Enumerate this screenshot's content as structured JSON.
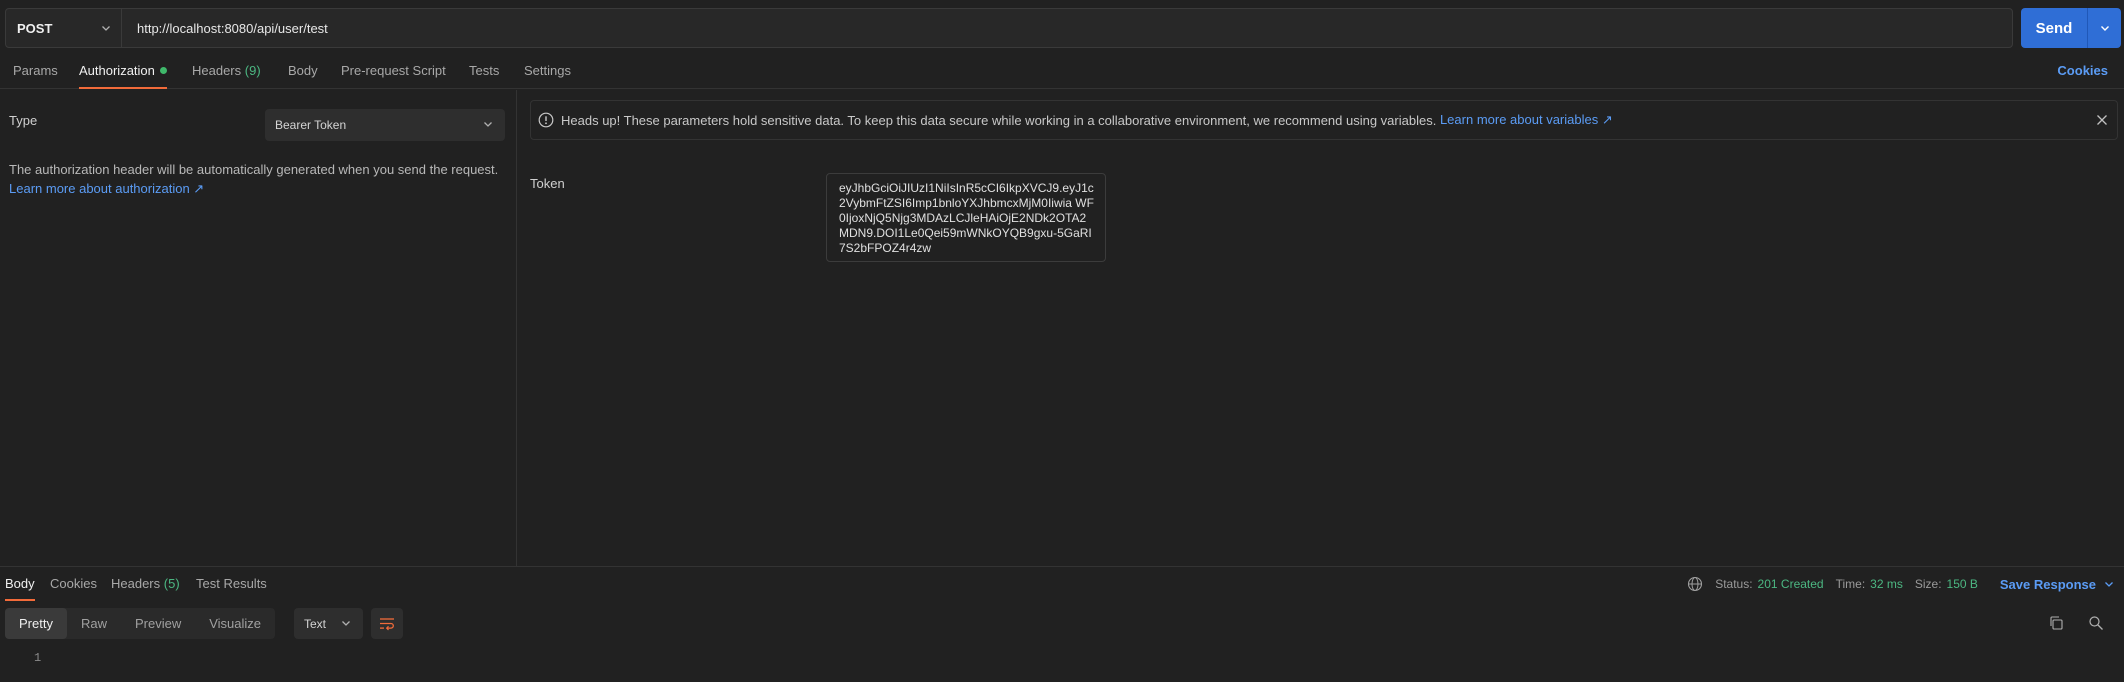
{
  "request": {
    "method": "POST",
    "url": "http://localhost:8080/api/user/test",
    "send_label": "Send"
  },
  "tabs": {
    "params": "Params",
    "authorization": "Authorization",
    "headers": "Headers",
    "headers_count": "(9)",
    "body": "Body",
    "prerequest": "Pre-request Script",
    "tests": "Tests",
    "settings": "Settings",
    "cookies": "Cookies"
  },
  "auth": {
    "type_label": "Type",
    "type_value": "Bearer Token",
    "description": "The authorization header will be automatically generated when you send the request.",
    "learn_link": "Learn more about authorization ↗",
    "banner_text": "Heads up! These parameters hold sensitive data. To keep this data secure while working in a collaborative environment, we recommend using variables.",
    "banner_link": "Learn more about variables ↗",
    "token_label": "Token",
    "token_value": "eyJhbGciOiJIUzI1NiIsInR5cCI6IkpXVCJ9.eyJ1c2VybmFtZSI6Imp1bnloYXJhbmcxMjM0Iiwia WF0IjoxNjQ5Njg3MDAzLCJleHAiOjE2NDk2OTA2MDN9.DOI1Le0Qei59mWNkOYQB9gxu-5GaRI7S2bFPOZ4r4zw"
  },
  "response": {
    "tabs": {
      "body": "Body",
      "cookies": "Cookies",
      "headers": "Headers",
      "headers_count": "(5)",
      "test_results": "Test Results"
    },
    "status_label": "Status:",
    "status_value": "201 Created",
    "time_label": "Time:",
    "time_value": "32 ms",
    "size_label": "Size:",
    "size_value": "150 B",
    "save_label": "Save Response",
    "views": {
      "pretty": "Pretty",
      "raw": "Raw",
      "preview": "Preview",
      "visualize": "Visualize"
    },
    "format": "Text",
    "line_number": "1"
  },
  "colors": {
    "accent": "#f26b3a",
    "send": "#2f6ed6",
    "link": "#5b9cf5",
    "success": "#4cb782"
  }
}
